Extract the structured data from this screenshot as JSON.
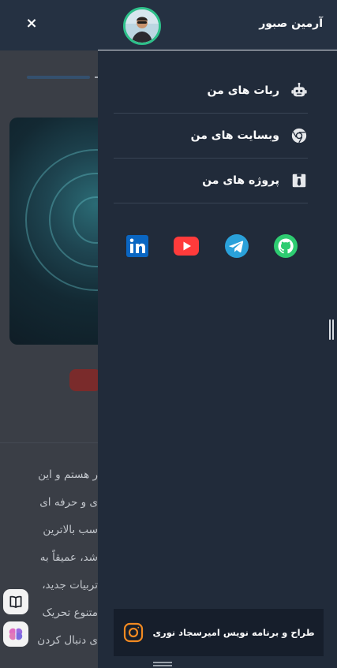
{
  "background": {
    "close_symbol": "×",
    "text_lines": [
      "ر هستم و این",
      "ی و حرفه ای",
      "سب بالاترین",
      "شد، عمیقاً به",
      "تربیات جدید،",
      "متنوع تحریک",
      "ی دنبال کردن"
    ],
    "fab_icons": [
      "book-icon",
      "brain-icon"
    ]
  },
  "drawer": {
    "user_name": "آرمین صبور",
    "menu": [
      {
        "label": "ربات های من",
        "icon": "robot-icon"
      },
      {
        "label": "وبسایت های من",
        "icon": "chrome-icon"
      },
      {
        "label": "پروژه های من",
        "icon": "project-icon"
      }
    ],
    "socials": [
      {
        "name": "linkedin",
        "icon": "linkedin-icon",
        "color": "#0a66c2"
      },
      {
        "name": "youtube",
        "icon": "youtube-icon",
        "color": "#ff3b3b"
      },
      {
        "name": "telegram",
        "icon": "telegram-icon",
        "color": "#2aa1da"
      },
      {
        "name": "github",
        "icon": "github-icon",
        "color": "#2ecc71"
      }
    ],
    "footer_credit": "طراح و برنامه نویس امیرسجاد نوری",
    "footer_icon": "instagram-icon"
  },
  "colors": {
    "drawer_bg": "#212b3a",
    "header_bg": "#253142",
    "footer_bg": "#161e2b",
    "avatar_ring": "#2ec08a",
    "instagram": "#f28a21"
  }
}
